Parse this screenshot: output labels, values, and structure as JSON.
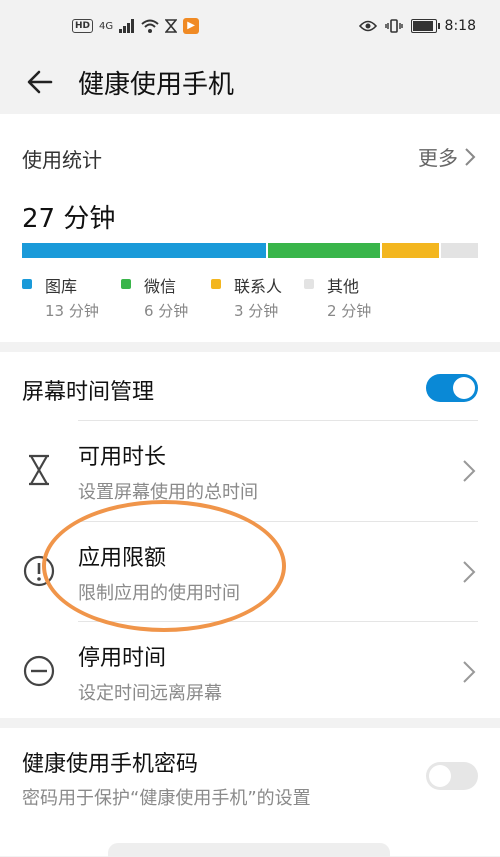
{
  "status_bar": {
    "hd": "HD",
    "network": "4G",
    "time": "8:18"
  },
  "header": {
    "title": "健康使用手机"
  },
  "usage": {
    "label": "使用统计",
    "more_label": "更多",
    "total": "27 分钟",
    "categories": [
      {
        "name": "图库",
        "value": "13 分钟",
        "minutes": 13,
        "color": "#1a9ad9"
      },
      {
        "name": "微信",
        "value": "6 分钟",
        "minutes": 6,
        "color": "#39b54a"
      },
      {
        "name": "联系人",
        "value": "3 分钟",
        "minutes": 3,
        "color": "#f3b61f"
      },
      {
        "name": "其他",
        "value": "2 分钟",
        "minutes": 2,
        "color": "#e3e3e3"
      }
    ]
  },
  "screen_time": {
    "title": "屏幕时间管理",
    "toggle_on": true,
    "items": [
      {
        "title": "可用时长",
        "subtitle": "设置屏幕使用的总时间",
        "icon": "hourglass-icon"
      },
      {
        "title": "应用限额",
        "subtitle": "限制应用的使用时间",
        "icon": "app-limit-icon"
      },
      {
        "title": "停用时间",
        "subtitle": "设定时间远离屏幕",
        "icon": "downtime-icon"
      }
    ]
  },
  "password": {
    "title": "健康使用手机密码",
    "subtitle": "密码用于保护“健康使用手机”的设置",
    "toggle_on": false
  },
  "colors": {
    "accent": "#0a89d6",
    "highlight": "#f0954a"
  }
}
